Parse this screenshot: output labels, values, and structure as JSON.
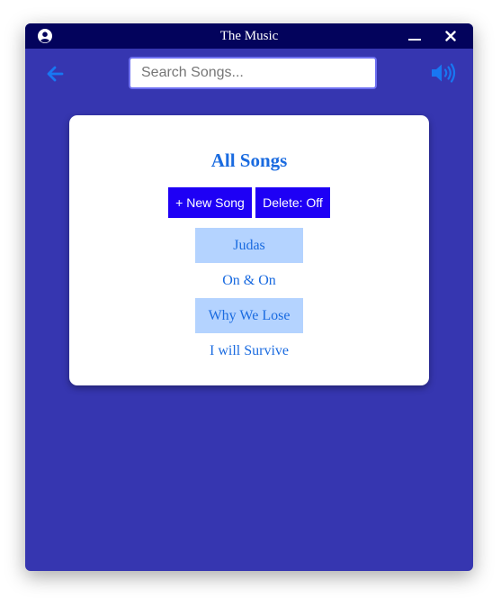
{
  "window": {
    "title": "The Music"
  },
  "search": {
    "placeholder": "Search Songs..."
  },
  "card": {
    "title": "All Songs",
    "new_song_label": "+ New Song",
    "delete_label": "Delete: Off"
  },
  "songs": [
    {
      "title": "Judas",
      "highlighted": true
    },
    {
      "title": "On & On",
      "highlighted": false
    },
    {
      "title": "Why We Lose",
      "highlighted": true
    },
    {
      "title": "I will Survive",
      "highlighted": false
    }
  ],
  "icons": {
    "user": "user-circle-icon",
    "minimize": "minimize-icon",
    "close": "close-icon",
    "back": "arrow-left-icon",
    "volume": "volume-icon"
  },
  "colors": {
    "background": "#3636b0",
    "titlebar": "#03035c",
    "accent": "#1a6be0",
    "button": "#1e00f5",
    "highlight": "#b4d3ff",
    "icon_blue": "#1877f2"
  }
}
